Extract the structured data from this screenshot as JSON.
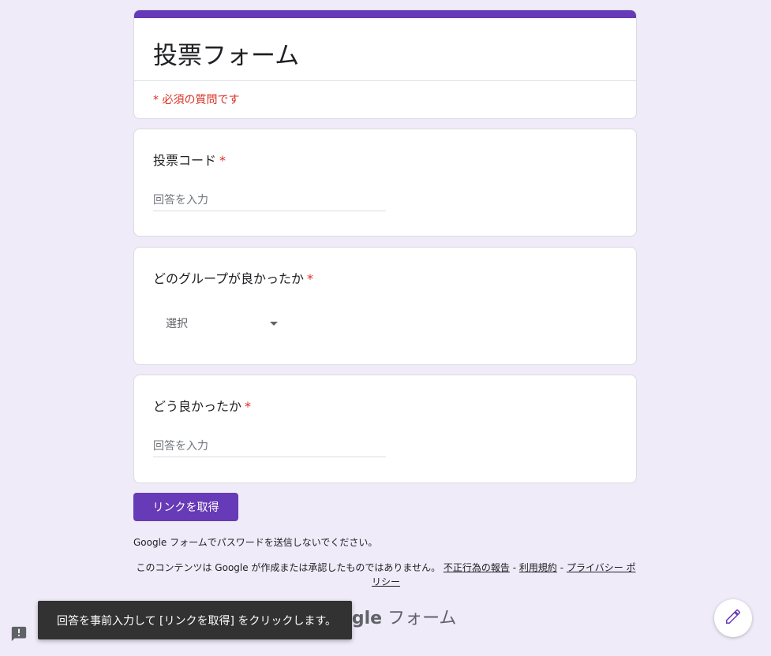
{
  "form": {
    "title": "投票フォーム",
    "required_note": "* 必須の質問です"
  },
  "questions": [
    {
      "label": "投票コード",
      "required_mark": "*",
      "placeholder": "回答を入力"
    },
    {
      "label": "どのグループが良かったか",
      "required_mark": "*",
      "dropdown_value": "選択"
    },
    {
      "label": "どう良かったか",
      "required_mark": "*",
      "placeholder": "回答を入力"
    }
  ],
  "actions": {
    "get_link_label": "リンクを取得"
  },
  "footer": {
    "password_warning": "Google フォームでパスワードを送信しないでください。",
    "disclaimer_text": "このコンテンツは Google が作成または承認したものではありません。",
    "report_link": "不正行為の報告",
    "separator": "-",
    "terms_link": "利用規約",
    "privacy_link": "プライバシー ポリシー",
    "brand_google": "Google",
    "brand_forms": "フォーム"
  },
  "snackbar": {
    "message": "回答を事前入力して [リンクを取得] をクリックします。"
  },
  "icons": {
    "report": "report-feedback-icon",
    "edit": "pencil-icon"
  },
  "colors": {
    "accent": "#673ab7",
    "required": "#d93025",
    "background": "#efebf8"
  }
}
